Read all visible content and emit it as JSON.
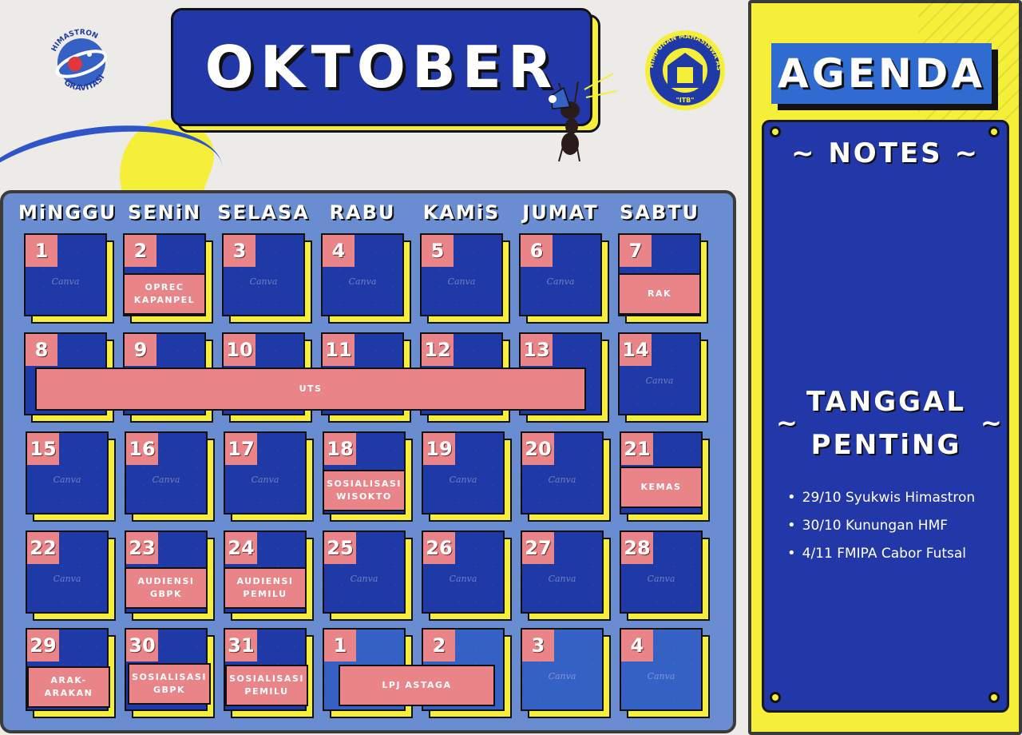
{
  "calendar": {
    "month": "OKTOBER",
    "watermark": "Canva",
    "days": [
      "MiNGGU",
      "SENiN",
      "SELASA",
      "RABU",
      "KAMiS",
      "JUMAT",
      "SABTU"
    ],
    "weeks": [
      [
        "1",
        "2",
        "3",
        "4",
        "5",
        "6",
        "7"
      ],
      [
        "8",
        "9",
        "10",
        "11",
        "12",
        "13",
        "14"
      ],
      [
        "15",
        "16",
        "17",
        "18",
        "19",
        "20",
        "21"
      ],
      [
        "22",
        "23",
        "24",
        "25",
        "26",
        "27",
        "28"
      ],
      [
        "29",
        "30",
        "31",
        "1",
        "2",
        "3",
        "4"
      ]
    ],
    "events": {
      "oprec": "OPREC\nKAPANPEL",
      "rak": "RAK",
      "uts": "UTS",
      "sosialisasi_wisokto": "SOSiALiSASi\nWiSOKTO",
      "kemas": "KEMAS",
      "audiensi_gbpk": "AUDiENSi\nGBPK",
      "audiensi_pemilu": "AUDiENSi\nPEMiLU",
      "arak": "ARAK-\nARAKAN",
      "sosialisasi_gbpk": "SOSiALiSASi\nGBPK",
      "sosialisasi_pemilu": "SOSiALiSASi\nPEMiLU",
      "lpj": "LPJ ASTAGA"
    }
  },
  "logos": {
    "left_text_top": "HIMASTRON",
    "left_text_bottom": "GRAVITASI",
    "right_text_top": "HIMPUNAN MAHASISWA ASTRONOMI",
    "right_text_bottom": "\"ITB\""
  },
  "agenda": {
    "title": "AGENDA",
    "notes_heading": "~ NOTES ~",
    "tilde": "~",
    "important_heading_line1": "TANGGAL",
    "important_heading_line2": "PENTiNG",
    "important_dates": [
      "29/10 Syukwis Himastron",
      "30/10 Kunungan HMF",
      "4/11 FMIPA Cabor Futsal"
    ]
  },
  "colors": {
    "navy": "#2338a8",
    "yellow": "#f6ef3a",
    "pink": "#e98588",
    "panel_blue": "#6a8dd2"
  }
}
